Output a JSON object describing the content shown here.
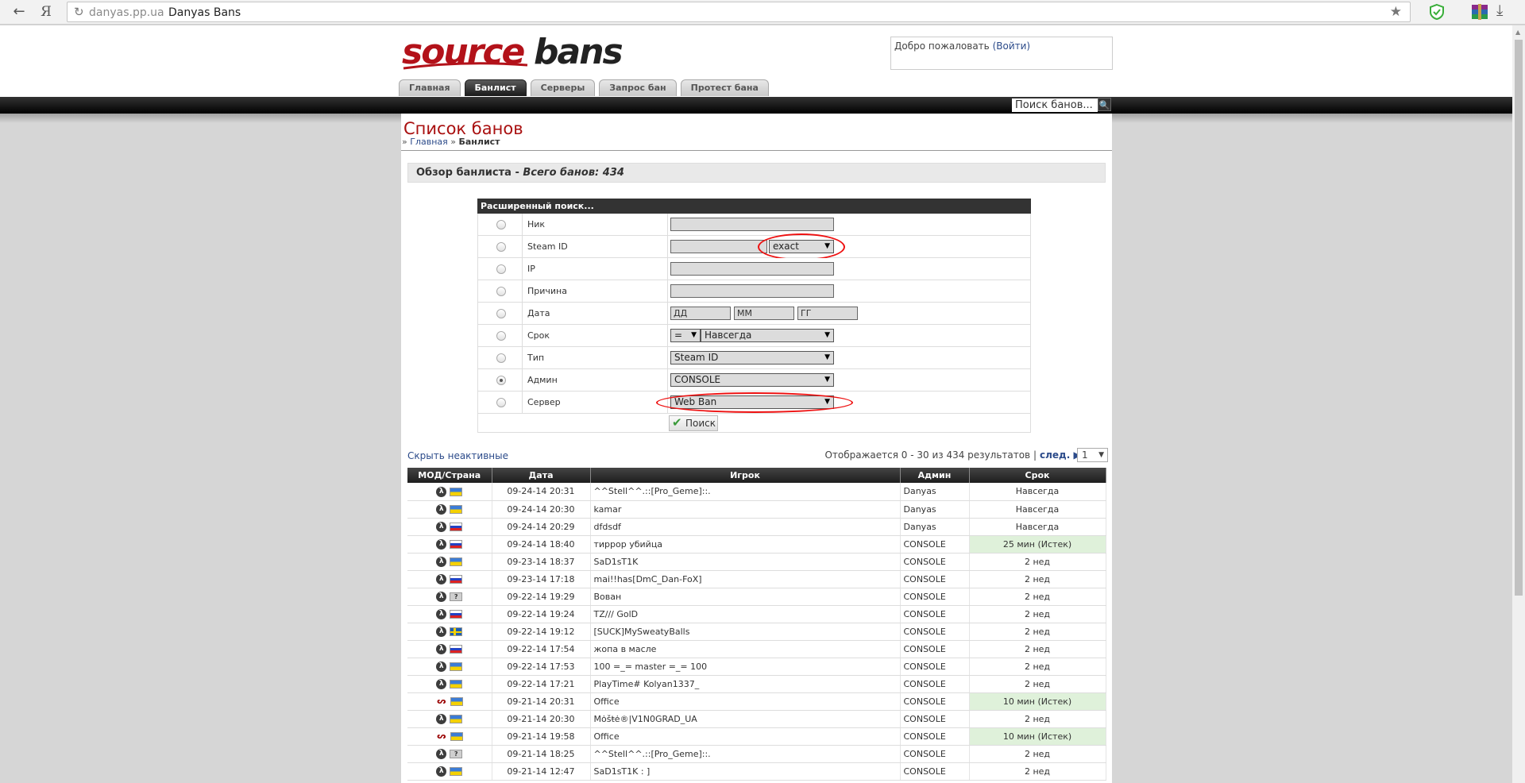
{
  "browser": {
    "back_icon": "←",
    "yandex_label": "Я",
    "reload_icon": "↻",
    "domain": "danyas.pp.ua",
    "page_title": "Danyas Bans",
    "star_icon": "★",
    "download_icon": "⤓"
  },
  "header": {
    "welcome_text": "Добро пожаловать",
    "login_link": "(Войти)",
    "search_placeholder": "Поиск банов...",
    "search_btn_icon": "🔍"
  },
  "tabs": [
    {
      "label": "Главная"
    },
    {
      "label": "Банлист"
    },
    {
      "label": "Серверы"
    },
    {
      "label": "Запрос бан"
    },
    {
      "label": "Протест бана"
    }
  ],
  "page": {
    "title": "Список банов",
    "breadcrumb_prefix": "»",
    "breadcrumb_home": "Главная",
    "breadcrumb_sep": "»",
    "breadcrumb_current": "Банлист",
    "overview_label": "Обзор банлиста - ",
    "overview_total": "Всего банов: 434"
  },
  "adv_search": {
    "header": "Расширенный поиск...",
    "rows": [
      {
        "label": "Ник"
      },
      {
        "label": "Steam ID",
        "select": "exact"
      },
      {
        "label": "IP"
      },
      {
        "label": "Причина"
      },
      {
        "label": "Дата",
        "day": "ДД",
        "month": "ММ",
        "year": "ГГ"
      },
      {
        "label": "Срок",
        "op": "=",
        "length": "Навсегда"
      },
      {
        "label": "Тип",
        "select": "Steam ID"
      },
      {
        "label": "Админ",
        "select": "CONSOLE"
      },
      {
        "label": "Сервер",
        "select": "Web Ban"
      }
    ],
    "submit": "Поиск",
    "select_caret": "▼",
    "check_icon": "✔"
  },
  "results": {
    "hide_inactive": "Скрыть неактивные",
    "pagination_text": "Отображается 0 - 30 из 434 результатов |",
    "next_label": "след. ▶",
    "page_value": "1",
    "columns": [
      "МОД/Страна",
      "Дата",
      "Игрок",
      "Админ",
      "Срок"
    ],
    "rows": [
      {
        "mod": "hl2",
        "flag": "ua",
        "date": "09-24-14 20:31",
        "player": "^^Stell^^.::[Pro_Geme]::.",
        "admin": "Danyas",
        "length": "Навсегда",
        "expired": false
      },
      {
        "mod": "hl2",
        "flag": "ua",
        "date": "09-24-14 20:30",
        "player": "kamar",
        "admin": "Danyas",
        "length": "Навсегда",
        "expired": false
      },
      {
        "mod": "hl2",
        "flag": "ru",
        "date": "09-24-14 20:29",
        "player": "dfdsdf",
        "admin": "Danyas",
        "length": "Навсегда",
        "expired": false
      },
      {
        "mod": "hl2",
        "flag": "ru",
        "date": "09-24-14 18:40",
        "player": "тиррор убийца",
        "admin": "CONSOLE",
        "length": "25 мин (Истек)",
        "expired": true
      },
      {
        "mod": "hl2",
        "flag": "ua",
        "date": "09-23-14 18:37",
        "player": "SaD1sT1K",
        "admin": "CONSOLE",
        "length": "2 нед",
        "expired": false
      },
      {
        "mod": "hl2",
        "flag": "ru",
        "date": "09-23-14 17:18",
        "player": "mai!!has[DmC_Dan-FoX]",
        "admin": "CONSOLE",
        "length": "2 нед",
        "expired": false
      },
      {
        "mod": "hl2",
        "flag": "unk",
        "date": "09-22-14 19:29",
        "player": "Вован",
        "admin": "CONSOLE",
        "length": "2 нед",
        "expired": false
      },
      {
        "mod": "hl2",
        "flag": "ru",
        "date": "09-22-14 19:24",
        "player": "TZ/// GolD",
        "admin": "CONSOLE",
        "length": "2 нед",
        "expired": false
      },
      {
        "mod": "hl2",
        "flag": "se",
        "date": "09-22-14 19:12",
        "player": "[SUCK]MySweatyBalls",
        "admin": "CONSOLE",
        "length": "2 нед",
        "expired": false
      },
      {
        "mod": "hl2",
        "flag": "ru",
        "date": "09-22-14 17:54",
        "player": "жопа в масле",
        "admin": "CONSOLE",
        "length": "2 нед",
        "expired": false
      },
      {
        "mod": "hl2",
        "flag": "ua",
        "date": "09-22-14 17:53",
        "player": "100 =_= master =_= 100",
        "admin": "CONSOLE",
        "length": "2 нед",
        "expired": false
      },
      {
        "mod": "hl2",
        "flag": "ua",
        "date": "09-22-14 17:21",
        "player": "PlayTime# Kolyan1337_",
        "admin": "CONSOLE",
        "length": "2 нед",
        "expired": false
      },
      {
        "mod": "sb",
        "flag": "ua",
        "date": "09-21-14 20:31",
        "player": "Office",
        "admin": "CONSOLE",
        "length": "10 мин (Истек)",
        "expired": true
      },
      {
        "mod": "hl2",
        "flag": "ua",
        "date": "09-21-14 20:30",
        "player": "Mȯšŧė®|V1N0GRAD_UA",
        "admin": "CONSOLE",
        "length": "2 нед",
        "expired": false
      },
      {
        "mod": "sb",
        "flag": "ua",
        "date": "09-21-14 19:58",
        "player": "Office",
        "admin": "CONSOLE",
        "length": "10 мин (Истек)",
        "expired": true
      },
      {
        "mod": "hl2",
        "flag": "unk",
        "date": "09-21-14 18:25",
        "player": "^^Stell^^.::[Pro_Geme]::.",
        "admin": "CONSOLE",
        "length": "2 нед",
        "expired": false
      },
      {
        "mod": "hl2",
        "flag": "ua",
        "date": "09-21-14 12:47",
        "player": "SaD1sT1K : ]",
        "admin": "CONSOLE",
        "length": "2 нед",
        "expired": false
      }
    ]
  }
}
